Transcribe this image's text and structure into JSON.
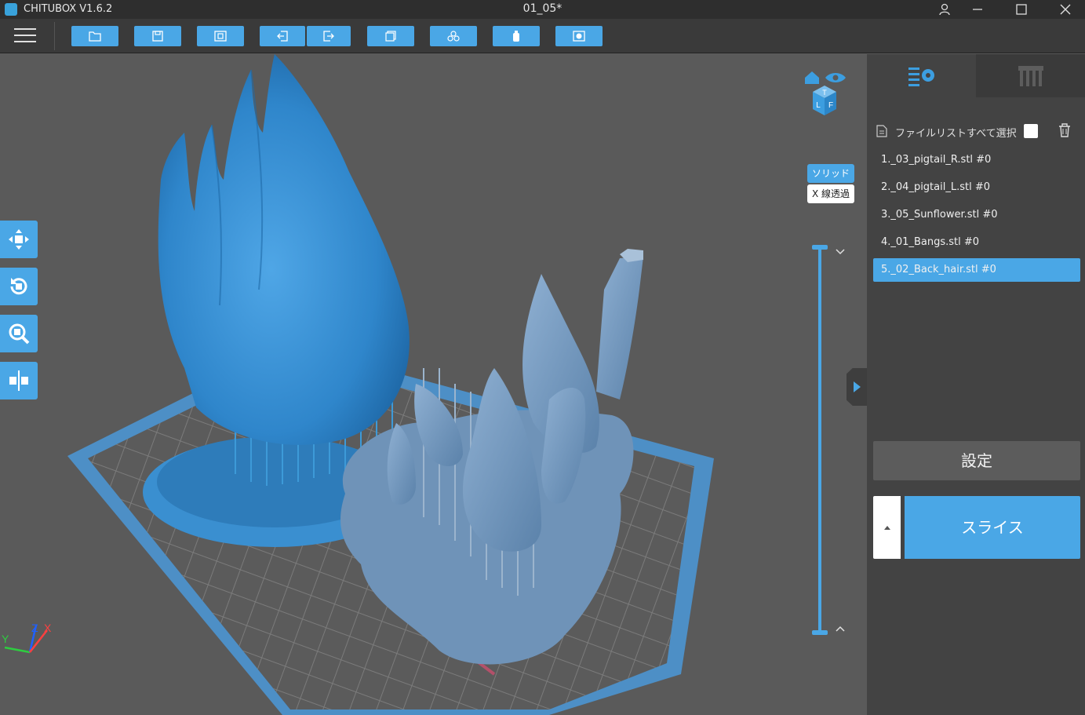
{
  "app": {
    "name": "CHITUBOX V1.6.2",
    "document_title": "01_05*"
  },
  "window_controls": {
    "user_icon": "user-icon",
    "minimize_icon": "minimize-icon",
    "maximize_icon": "maximize-icon",
    "close_icon": "close-icon"
  },
  "toolbar": {
    "buttons": [
      {
        "icon": "open-file-icon"
      },
      {
        "icon": "save-icon"
      },
      {
        "icon": "screenshot-icon"
      },
      {
        "icon": "import-icon"
      },
      {
        "icon": "export-icon"
      },
      {
        "icon": "copy-layers-icon"
      },
      {
        "icon": "arrange-icon"
      },
      {
        "icon": "bottle-icon"
      },
      {
        "icon": "hollow-icon"
      }
    ]
  },
  "viewport": {
    "modes": {
      "solid": "ソリッド",
      "xray": "X 線透過"
    },
    "view_cube_letters": {
      "top": "T",
      "left": "L",
      "front": "F"
    },
    "axes": {
      "x": "X",
      "y": "Y",
      "z": "Z"
    },
    "side_tools": [
      "move-icon",
      "rotate-icon",
      "scale-icon",
      "mirror-icon"
    ]
  },
  "panel": {
    "tabs": [
      "settings-tab-icon",
      "supports-tab-icon"
    ],
    "filelist": {
      "select_all_label": "ファイルリストすべて選択",
      "files": [
        {
          "label": "1._03_pigtail_R.stl #0",
          "selected": false
        },
        {
          "label": "2._04_pigtail_L.stl #0",
          "selected": false
        },
        {
          "label": "3._05_Sunflower.stl #0",
          "selected": false
        },
        {
          "label": "4._01_Bangs.stl #0",
          "selected": false
        },
        {
          "label": "5._02_Back_hair.stl #0",
          "selected": true
        }
      ]
    },
    "settings_label": "設定",
    "slice_label": "スライス"
  },
  "colors": {
    "accent": "#4aa7e6",
    "model_selected": "#3e93d4",
    "model_other": "#6f98c0",
    "background": "#5a5a5a",
    "panel": "#434343"
  }
}
